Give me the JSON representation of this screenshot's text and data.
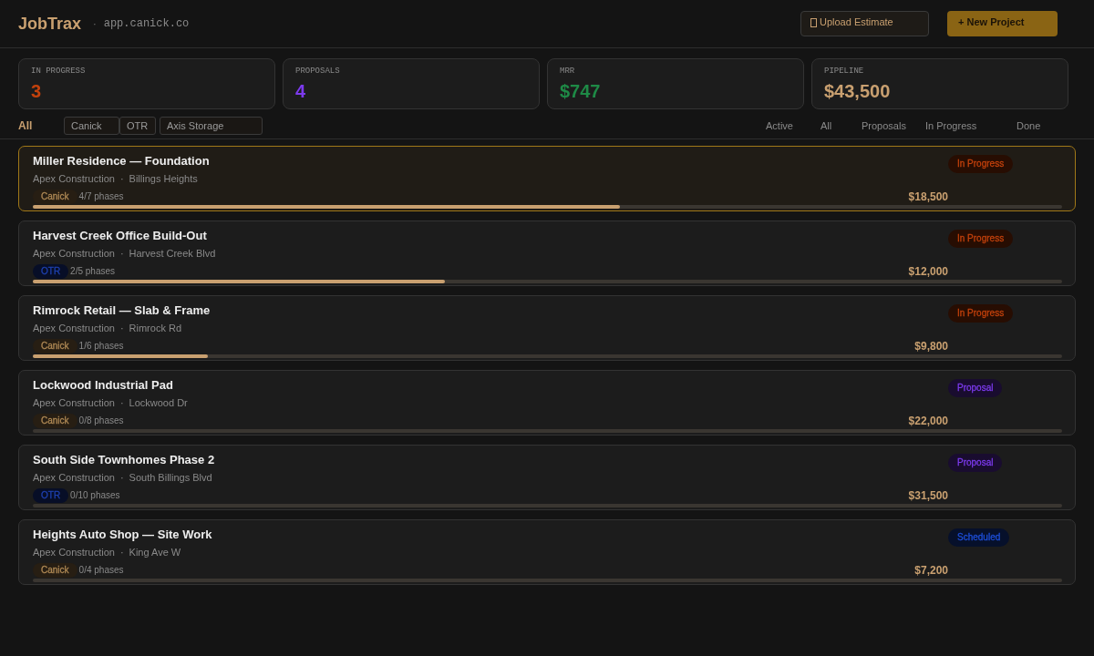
{
  "header": {
    "logo": "JobTrax",
    "separator": "·",
    "domain": "app.canick.co",
    "buttons": [
      {
        "kind": "outline",
        "label": "Upload Estimate"
      },
      {
        "kind": "primary",
        "label": "+ New Project"
      }
    ]
  },
  "stats": [
    {
      "label": "IN PROGRESS",
      "value": "3",
      "color": "#c2410c"
    },
    {
      "label": "PROPOSALS",
      "value": "4",
      "color": "#7c3aed"
    },
    {
      "label": "MRR",
      "value": "$747",
      "color": "#1e8a46"
    },
    {
      "label": "PIPELINE",
      "value": "$43,500",
      "color": "#c9a070"
    }
  ],
  "client_filters": [
    {
      "label": "All",
      "selected": true
    },
    {
      "label": "Canick",
      "selected": false
    },
    {
      "label": "OTR",
      "selected": false
    },
    {
      "label": "Axis Storage",
      "selected": false
    }
  ],
  "status_tabs": [
    {
      "label": "Active",
      "selected": false
    },
    {
      "label": "All",
      "selected": false
    },
    {
      "label": "Proposals",
      "selected": false
    },
    {
      "label": "In Progress",
      "selected": false
    },
    {
      "label": "Done",
      "selected": false
    }
  ],
  "projects": [
    {
      "title": "Miller Residence — Foundation",
      "client": "Apex Construction",
      "separator": "·",
      "location": "Billings Heights",
      "tag": {
        "label": "Canick",
        "color": "#b08a55"
      },
      "phases": "4/7 phases",
      "amount": "$18,500",
      "level": 0.57,
      "status": {
        "label": "In Progress",
        "color": "#c2410c"
      },
      "selected": true
    },
    {
      "title": "Harvest Creek Office Build-Out",
      "client": "Apex Construction",
      "separator": "·",
      "location": "Harvest Creek Blvd",
      "tag": {
        "label": "OTR",
        "color": "#1e40af"
      },
      "phases": "2/5 phases",
      "amount": "$12,000",
      "level": 0.4,
      "status": {
        "label": "In Progress",
        "color": "#c2410c"
      },
      "selected": false
    },
    {
      "title": "Rimrock Retail — Slab & Frame",
      "client": "Apex Construction",
      "separator": "·",
      "location": "Rimrock Rd",
      "tag": {
        "label": "Canick",
        "color": "#b08a55"
      },
      "phases": "1/6 phases",
      "amount": "$9,800",
      "level": 0.17,
      "status": {
        "label": "In Progress",
        "color": "#c2410c"
      },
      "selected": false
    },
    {
      "title": "Lockwood Industrial Pad",
      "client": "Apex Construction",
      "separator": "·",
      "location": "Lockwood Dr",
      "tag": {
        "label": "Canick",
        "color": "#b08a55"
      },
      "phases": "0/8 phases",
      "amount": "$22,000",
      "level": 0,
      "status": {
        "label": "Proposal",
        "color": "#7c3aed"
      },
      "selected": false
    },
    {
      "title": "South Side Townhomes Phase 2",
      "client": "Apex Construction",
      "separator": "·",
      "location": "South Billings Blvd",
      "tag": {
        "label": "OTR",
        "color": "#1e40af"
      },
      "phases": "0/10 phases",
      "amount": "$31,500",
      "level": 0,
      "status": {
        "label": "Proposal",
        "color": "#7c3aed"
      },
      "selected": false
    },
    {
      "title": "Heights Auto Shop — Site Work",
      "client": "Apex Construction",
      "separator": "·",
      "location": "King Ave W",
      "tag": {
        "label": "Canick",
        "color": "#b08a55"
      },
      "phases": "0/4 phases",
      "amount": "$7,200",
      "level": 0,
      "status": {
        "label": "Scheduled",
        "color": "#1d4ed8"
      },
      "selected": false
    }
  ]
}
